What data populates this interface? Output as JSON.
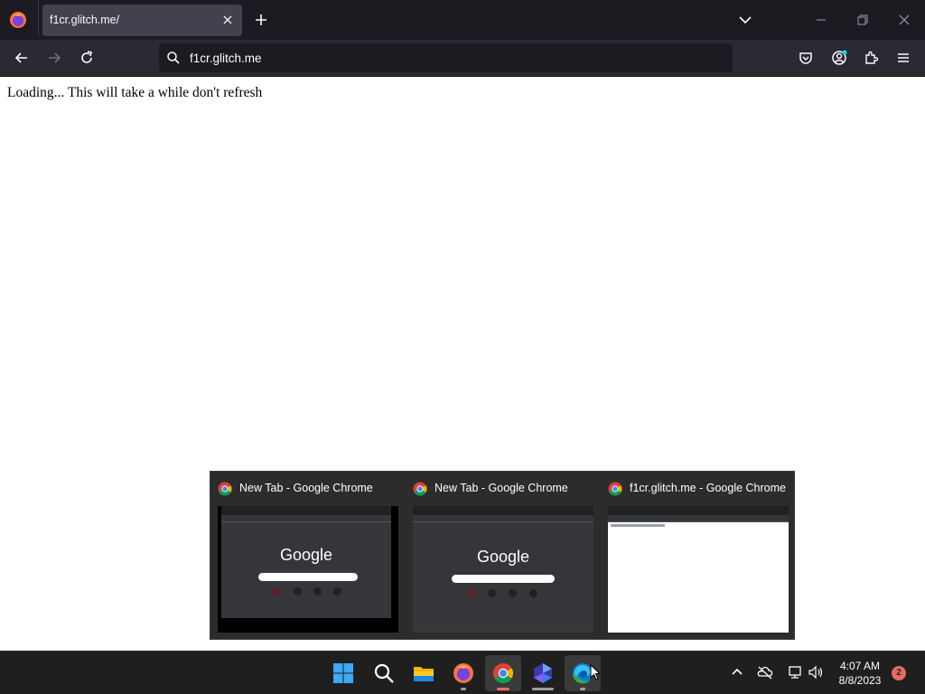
{
  "browser": {
    "tab": {
      "title": "f1cr.glitch.me/"
    },
    "urlbar": {
      "value": "f1cr.glitch.me"
    }
  },
  "page": {
    "message": "Loading... This will take a while don't refresh"
  },
  "thumbnails": [
    {
      "title": "New Tab - Google Chrome",
      "preview_logo": "Google",
      "kind": "newtab",
      "selected": true
    },
    {
      "title": "New Tab - Google Chrome",
      "preview_logo": "Google",
      "kind": "newtab",
      "selected": false
    },
    {
      "title": "f1cr.glitch.me - Google Chrome",
      "preview_logo": "",
      "kind": "blank",
      "selected": false
    }
  ],
  "taskbar": {
    "apps": [
      "start-icon",
      "search-icon",
      "file-explorer-icon",
      "firefox-icon",
      "chrome-icon",
      "bing-icon",
      "edge-icon"
    ],
    "clock": {
      "time": "4:07 AM",
      "date": "8/8/2023"
    },
    "notification_count": "2"
  },
  "colors": {
    "firefox_chrome": "#1c1b22",
    "navbar": "#2b2a33",
    "taskbar": "#1f1f1f",
    "chrome_indicator": "#e86b5f"
  }
}
